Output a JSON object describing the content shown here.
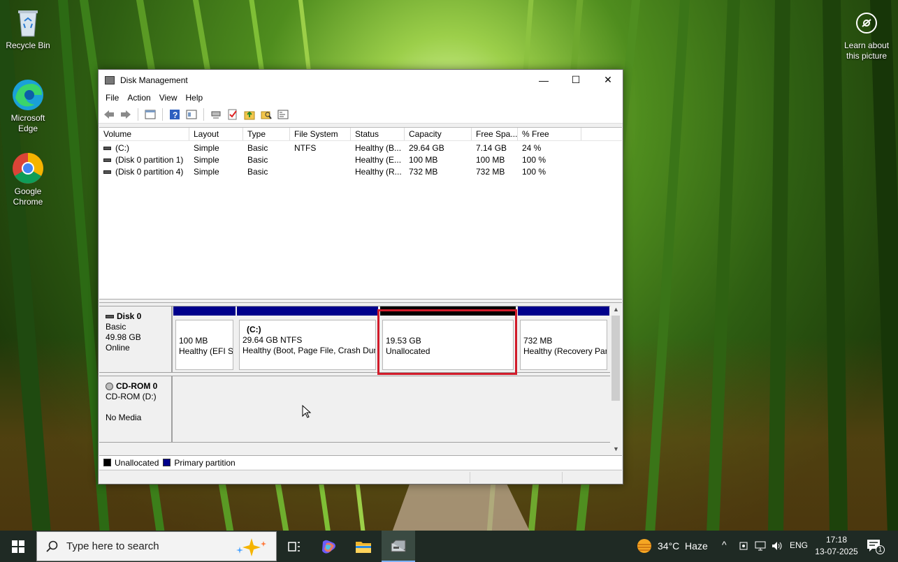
{
  "desktop": {
    "icons": [
      {
        "label": "Recycle Bin",
        "icon": "recycle-bin-icon"
      },
      {
        "label": "Microsoft Edge",
        "icon": "edge-icon"
      },
      {
        "label": "Google Chrome",
        "icon": "chrome-icon"
      }
    ],
    "learn_label": "Learn about this picture"
  },
  "window": {
    "title": "Disk Management",
    "controls": {
      "minimize": "—",
      "maximize": "☐",
      "close": "✕"
    },
    "menu": [
      "File",
      "Action",
      "View",
      "Help"
    ],
    "volume_table": {
      "columns": [
        "Volume",
        "Layout",
        "Type",
        "File System",
        "Status",
        "Capacity",
        "Free Spa...",
        "% Free"
      ],
      "rows": [
        [
          "(C:)",
          "Simple",
          "Basic",
          "NTFS",
          "Healthy (B...",
          "29.64 GB",
          "7.14 GB",
          "24 %"
        ],
        [
          "(Disk 0 partition 1)",
          "Simple",
          "Basic",
          "",
          "Healthy (E...",
          "100 MB",
          "100 MB",
          "100 %"
        ],
        [
          "(Disk 0 partition 4)",
          "Simple",
          "Basic",
          "",
          "Healthy (R...",
          "732 MB",
          "732 MB",
          "100 %"
        ]
      ]
    },
    "disks": [
      {
        "name": "Disk 0",
        "type": "Basic",
        "size": "49.98 GB",
        "status": "Online",
        "partitions": [
          {
            "title": "",
            "size": "100 MB",
            "status": "Healthy (EFI Sy",
            "color": "#00008b"
          },
          {
            "title": "(C:)",
            "size": "29.64 GB NTFS",
            "status": "Healthy (Boot, Page File, Crash Dum",
            "color": "#00008b"
          },
          {
            "title": "",
            "size": "19.53 GB",
            "status": "Unallocated",
            "color": "#000000"
          },
          {
            "title": "",
            "size": "732 MB",
            "status": "Healthy (Recovery Par",
            "color": "#00008b"
          }
        ]
      },
      {
        "name": "CD-ROM 0",
        "type": "CD-ROM (D:)",
        "status": "No Media"
      }
    ],
    "legend": [
      {
        "label": "Unallocated",
        "color": "#000000"
      },
      {
        "label": "Primary partition",
        "color": "#00008b"
      }
    ],
    "selection_color": "#d11b2a"
  },
  "taskbar": {
    "search_placeholder": "Type here to search",
    "weather": "34°C  Haze",
    "language": "ENG",
    "time": "17:18",
    "date": "13-07-2025",
    "notification_count": "1"
  }
}
